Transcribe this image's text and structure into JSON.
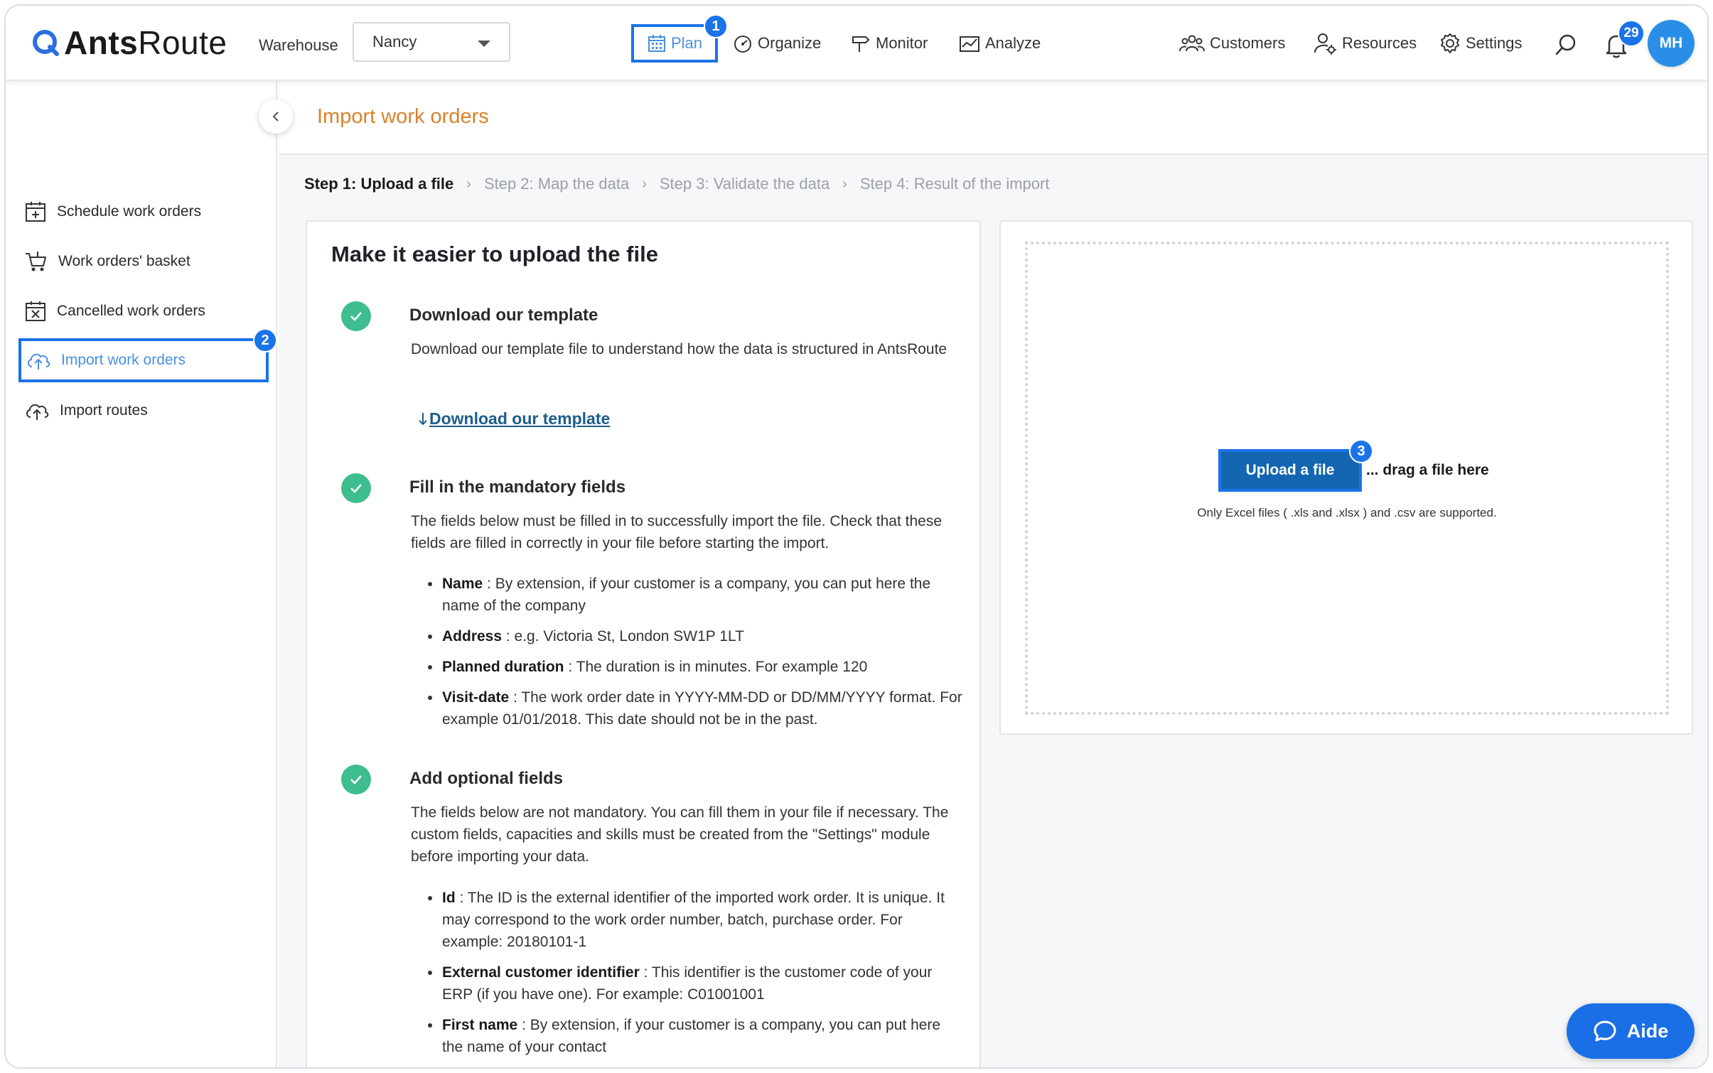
{
  "header": {
    "logo_prefix": "Ants",
    "logo_suffix": "Route",
    "warehouse_label": "Warehouse",
    "warehouse_value": "Nancy",
    "nav": [
      {
        "label": "Plan",
        "icon": "calendar-icon"
      },
      {
        "label": "Organize",
        "icon": "gauge-icon"
      },
      {
        "label": "Monitor",
        "icon": "signpost-icon"
      },
      {
        "label": "Analyze",
        "icon": "chart-icon"
      }
    ],
    "right_nav": [
      {
        "label": "Customers",
        "icon": "customers-icon"
      },
      {
        "label": "Resources",
        "icon": "resources-icon"
      },
      {
        "label": "Settings",
        "icon": "gear-icon"
      }
    ],
    "notifications_count": "29",
    "avatar_initials": "MH"
  },
  "callouts": {
    "one": "1",
    "two": "2",
    "three": "3"
  },
  "sidebar": {
    "items": [
      {
        "label": "Schedule work orders",
        "icon": "calendar-plus-icon"
      },
      {
        "label": "Work orders' basket",
        "icon": "cart-icon"
      },
      {
        "label": "Cancelled work orders",
        "icon": "calendar-x-icon"
      },
      {
        "label": "Import work orders",
        "icon": "cloud-upload-icon"
      },
      {
        "label": "Import routes",
        "icon": "cloud-upload-icon"
      }
    ]
  },
  "page": {
    "title": "Import work orders",
    "steps": [
      "Step 1: Upload a file",
      "Step 2: Map the data",
      "Step 3: Validate the data",
      "Step 4: Result of the import"
    ]
  },
  "guide": {
    "title": "Make it easier to upload the file",
    "template": {
      "title": "Download our template",
      "text": "Download our template file to understand how the data is structured in AntsRoute",
      "link": "Download our template"
    },
    "mandatory": {
      "title": "Fill in the mandatory fields",
      "text": "The fields below must be filled in to successfully import the file. Check that these fields are filled in correctly in your file before starting the import.",
      "fields": [
        {
          "name": "Name",
          "desc": " : By extension, if your customer is a company, you can put here the name of the company"
        },
        {
          "name": "Address",
          "desc": " : e.g. Victoria St, London SW1P 1LT"
        },
        {
          "name": "Planned duration",
          "desc": " : The duration is in minutes. For example 120"
        },
        {
          "name": "Visit-date",
          "desc": " : The work order date in YYYY-MM-DD or DD/MM/YYYY format. For example 01/01/2018. This date should not be in the past."
        }
      ]
    },
    "optional": {
      "title": "Add optional fields",
      "text": "The fields below are not mandatory. You can fill them in your file if necessary. The custom fields, capacities and skills must be created from the \"Settings\" module before importing your data.",
      "fields": [
        {
          "name": "Id",
          "desc": " : The ID is the external identifier of the imported work order. It is unique. It may correspond to the work order number, batch, purchase order. For example: 20180101-1"
        },
        {
          "name": "External customer identifier",
          "desc": " : This identifier is the customer code of your ERP (if you have one). For example: C01001001"
        },
        {
          "name": "First name",
          "desc": " : By extension, if your customer is a company, you can put here the name of your contact"
        }
      ]
    }
  },
  "upload": {
    "button": "Upload a file",
    "drag": "... drag a file here",
    "hint": "Only Excel files ( .xls and .xlsx ) and .csv are supported."
  },
  "help": {
    "label": "Aide"
  }
}
